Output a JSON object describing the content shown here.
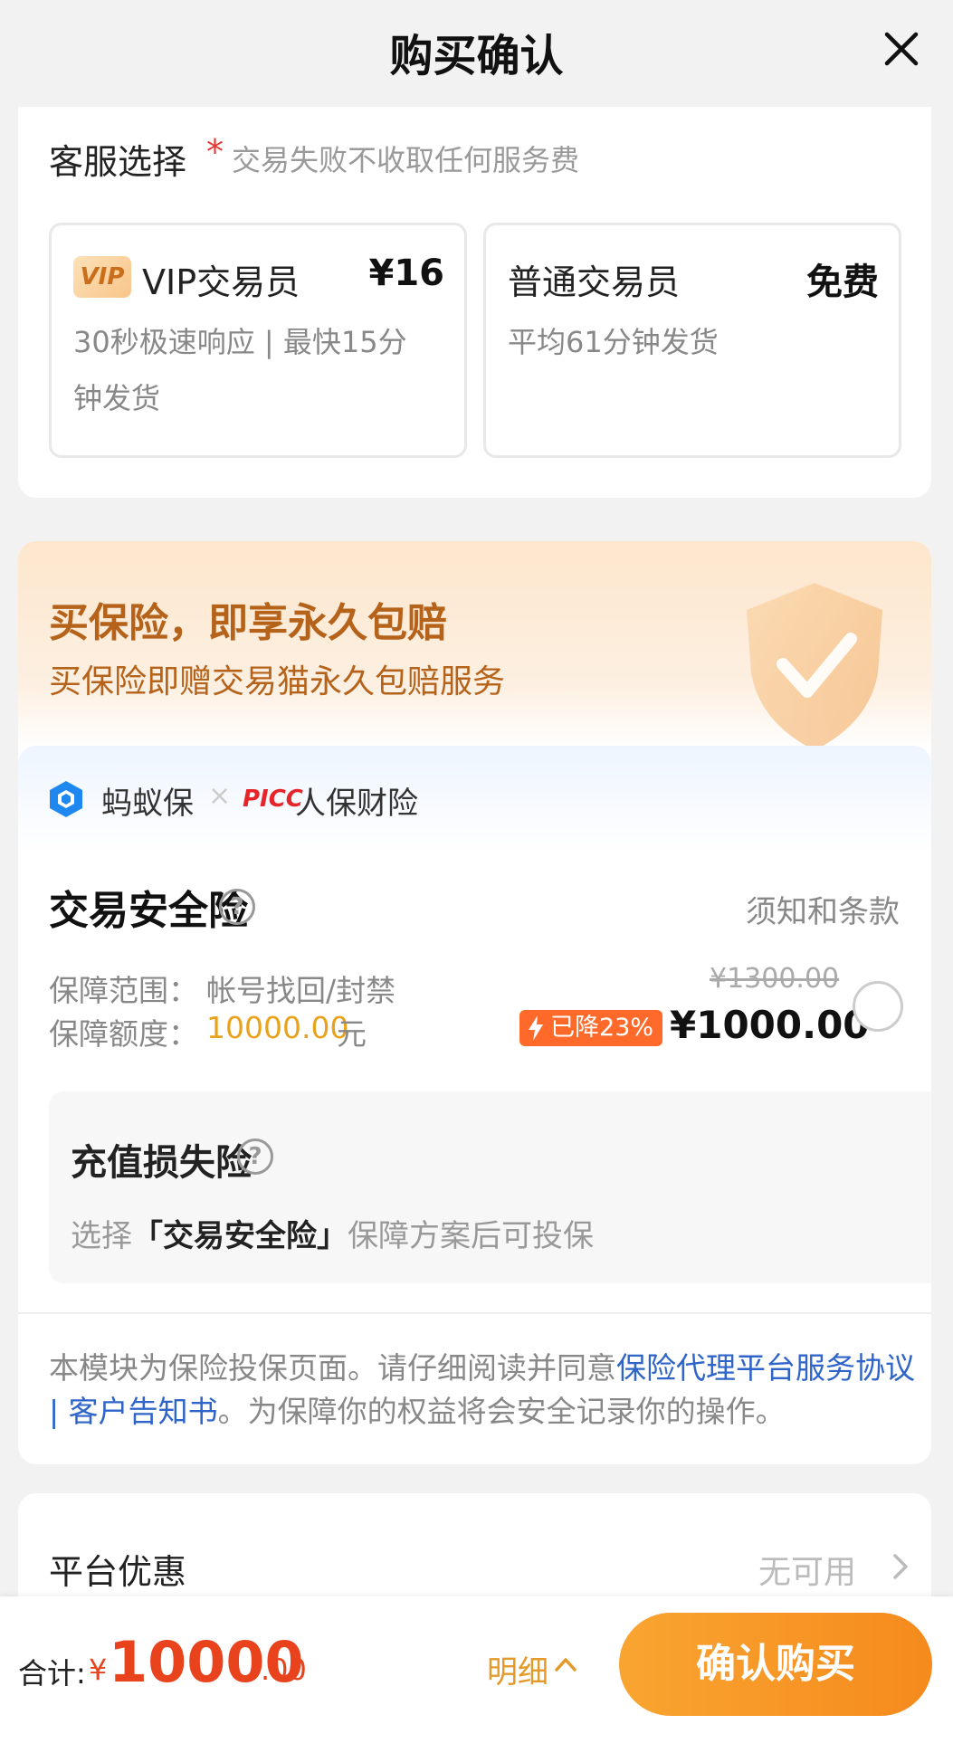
{
  "header": {
    "title": "购买确认"
  },
  "service": {
    "title": "客服选择",
    "required_mark": "*",
    "note": "交易失败不收取任何服务费",
    "options": [
      {
        "badge": "VIP",
        "name": "VIP交易员",
        "price": "¥16",
        "desc_line1": "30秒极速响应 | 最快15分",
        "desc_line2": "钟发货"
      },
      {
        "name": "普通交易员",
        "price": "免费",
        "desc_line1": "平均61分钟发货"
      }
    ]
  },
  "insurance": {
    "banner_title": "买保险，即享永久包赔",
    "banner_subtitle": "买保险即赠交易猫永久包赔服务",
    "partner1": "蚂蚁保",
    "separator": "×",
    "partner2_logo": "PICC",
    "partner2": "人保财险",
    "plan_title": "交易安全险",
    "terms": "须知和条款",
    "coverage_label": "保障范围：",
    "coverage_value": "帐号找回/封禁",
    "amount_label": "保障额度：",
    "amount_value": "10000.00",
    "amount_unit": "元",
    "original_price": "¥1300.00",
    "discount": "已降23%",
    "price": "¥1000.00",
    "sub_plan_title": "充值损失险",
    "sub_plan_desc_prefix": "选择",
    "sub_plan_desc_bold": "「交易安全险」",
    "sub_plan_desc_suffix": "保障方案后可投保",
    "agreement_text": "本模块为保险投保页面。请仔细阅读并同意",
    "agreement_link": "保险代理平台服务协议 | 客户告知书",
    "agreement_tail": "。为保障你的权益将会安全记录你的操作。"
  },
  "platform_discount": {
    "label": "平台优惠",
    "value": "无可用"
  },
  "bottom": {
    "total_label": "合计:",
    "currency": "¥",
    "total_int": "10000",
    "total_dec": ".00",
    "detail": "明细",
    "confirm": "确认购买"
  },
  "colors": {
    "accent": "#f58a1d",
    "price_red": "#e8431d",
    "link_blue": "#2f64c8",
    "gold": "#e8a21c"
  }
}
